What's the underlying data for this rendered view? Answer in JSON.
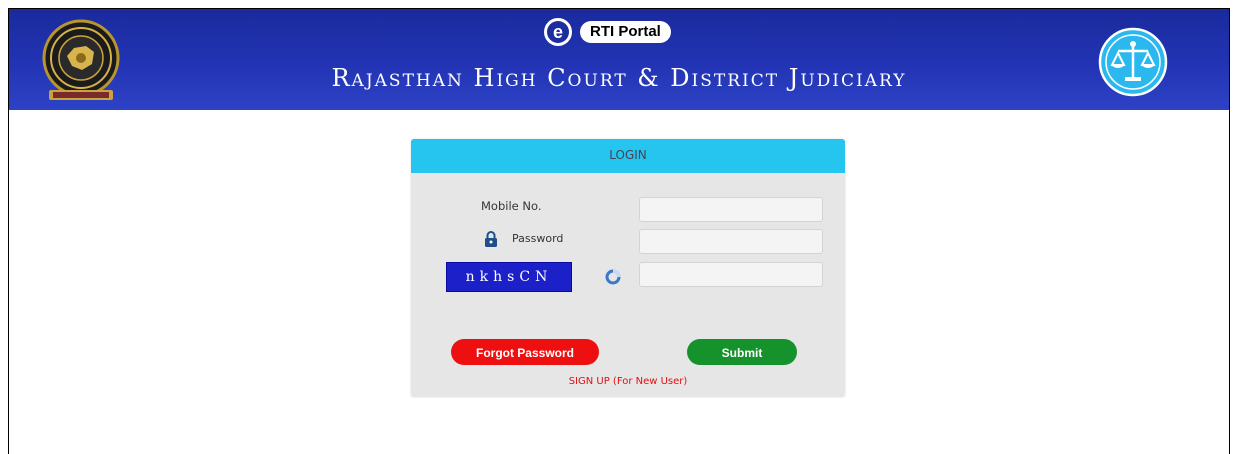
{
  "header": {
    "badge_letter": "e",
    "badge_label": "RTI Portal",
    "title": "Rajasthan High Court & District Judiciary",
    "left_emblem_icon": "high-court-emblem-icon",
    "right_logo_icon": "scales-of-justice-icon",
    "colors": {
      "band": "#2234b4",
      "text": "#ffffff"
    }
  },
  "login": {
    "heading": "LOGIN",
    "mobile_label": "Mobile No.",
    "mobile_value": "",
    "password_label": "Password",
    "password_value": "",
    "captcha_text": "nkhsCN",
    "captcha_input_value": "",
    "forgot_label": "Forgot Password",
    "submit_label": "Submit",
    "signup_label": "SIGN UP (For New User)",
    "colors": {
      "heading_bar": "#26c5f0",
      "forgot": "#ee1010",
      "submit": "#16922c",
      "signup_link": "#e01010",
      "captcha_bg": "#1c20c8"
    }
  }
}
